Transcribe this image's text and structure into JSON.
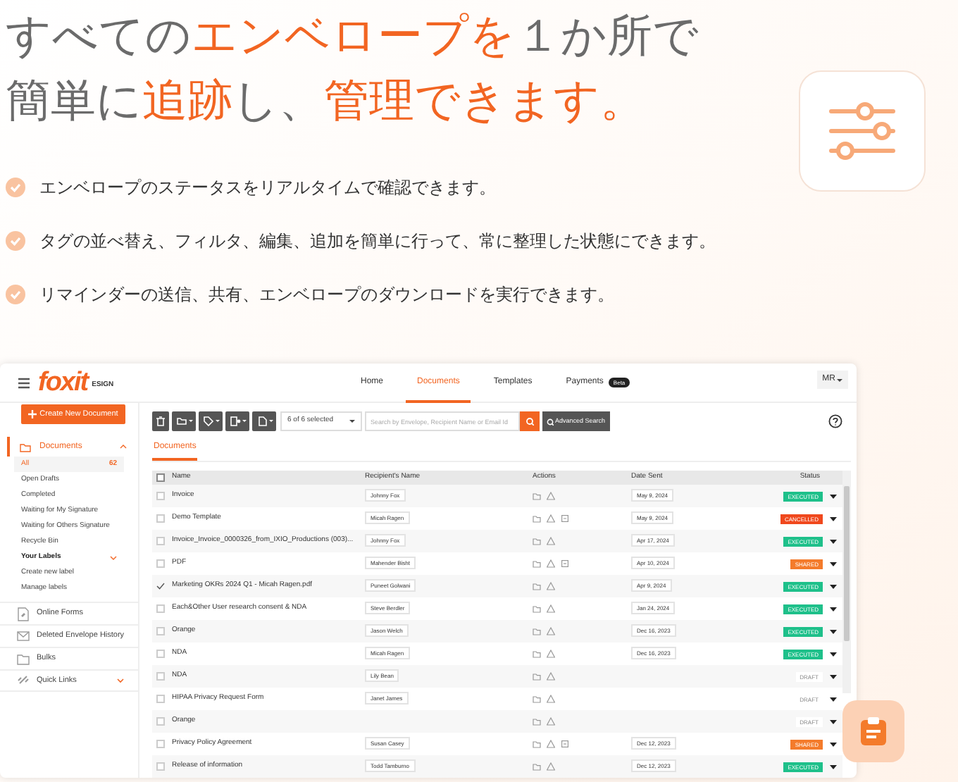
{
  "headline": [
    [
      {
        "text": "すべての",
        "accent": false
      },
      {
        "text": "エンベロープを",
        "accent": true
      },
      {
        "text": "１か所で",
        "accent": false
      }
    ],
    [
      {
        "text": "簡単に",
        "accent": false
      },
      {
        "text": "追跡",
        "accent": true
      },
      {
        "text": "し、",
        "accent": false
      },
      {
        "text": "管理できます。",
        "accent": true
      }
    ]
  ],
  "features": [
    "エンベロープのステータスをリアルタイムで確認できます。",
    "タグの並べ替え、フィルタ、編集、追加を簡単に行って、常に整理した状態にできます。",
    "リマインダーの送信、共有、エンベロープのダウンロードを実行できます。"
  ],
  "app": {
    "logo": "foxit",
    "logo_suffix": "ESIGN",
    "nav": [
      {
        "label": "Home",
        "selected": false
      },
      {
        "label": "Documents",
        "selected": true
      },
      {
        "label": "Templates",
        "selected": false
      },
      {
        "label": "Payments",
        "selected": false,
        "badge": "Beta"
      }
    ],
    "user_menu": "MR",
    "sidebar": {
      "create_button": "Create New Document",
      "folder": {
        "label": "Documents",
        "expanded": true,
        "children": [
          {
            "label": "All",
            "count": "62",
            "selected": true
          },
          {
            "label": "Open Drafts",
            "selected": false
          },
          {
            "label": "Completed",
            "selected": false
          },
          {
            "label": "Waiting for My Signature",
            "selected": false
          },
          {
            "label": "Waiting for Others Signature",
            "selected": false
          },
          {
            "label": "Recycle Bin",
            "selected": false
          }
        ]
      },
      "labels": {
        "label": "Your Labels",
        "expanded": true,
        "children": [
          {
            "label": "Create new label"
          },
          {
            "label": "Manage labels"
          }
        ]
      },
      "sections": [
        {
          "label": "Online Forms",
          "kind": "forms"
        },
        {
          "label": "Deleted Envelope History",
          "kind": "history"
        },
        {
          "label": "Bulks",
          "kind": "bulks"
        },
        {
          "label": "Quick Links",
          "kind": "links",
          "expanded": false
        }
      ]
    },
    "selection": "6 of 6 selected",
    "search": {
      "placeholder": "Search by Envelope, Recipient Name or Email Id"
    },
    "advanced_search": "Advanced Search",
    "tab": "Documents",
    "table": {
      "all_checked": false,
      "columns": [
        "Name",
        "Recipient's Name",
        "Actions",
        "Date Sent",
        "Status"
      ],
      "rows": [
        {
          "name": "Invoice",
          "recipient": "Johnny Fox",
          "copy_action": false,
          "date": "May 9, 2024",
          "status": "EXECUTED",
          "color": "#1ec08a",
          "checked": false
        },
        {
          "name": "Demo Template",
          "recipient": "Micah Ragen",
          "copy_action": true,
          "date": "May 9, 2024",
          "status": "CANCELLED",
          "color": "#f0481d",
          "checked": false
        },
        {
          "name": "Invoice_Invoice_0000326_from_IXIO_Productions (003)...",
          "recipient": "Johnny Fox",
          "copy_action": false,
          "date": "Apr 17, 2024",
          "status": "EXECUTED",
          "color": "#1ec08a",
          "checked": false
        },
        {
          "name": "PDF",
          "recipient": "Mahender Bisht",
          "copy_action": true,
          "date": "Apr 10, 2024",
          "status": "SHARED",
          "color": "#f47b2b",
          "checked": false
        },
        {
          "name": "Marketing OKRs 2024 Q1 - Micah Ragen.pdf",
          "recipient": "Puneet Golwani",
          "copy_action": false,
          "date": "Apr 9, 2024",
          "status": "EXECUTED",
          "color": "#1ec08a",
          "checked": true
        },
        {
          "name": "Each&Other User research consent & NDA",
          "recipient": "Steve Berdler",
          "copy_action": false,
          "date": "Jan 24, 2024",
          "status": "EXECUTED",
          "color": "#1ec08a",
          "checked": false
        },
        {
          "name": "Orange",
          "recipient": "Jason Welch",
          "copy_action": false,
          "date": "Dec 16, 2023",
          "status": "EXECUTED",
          "color": "#1ec08a",
          "checked": false
        },
        {
          "name": "NDA",
          "recipient": "Micah Ragen",
          "copy_action": false,
          "date": "Dec 16, 2023",
          "status": "EXECUTED",
          "color": "#1ec08a",
          "checked": false
        },
        {
          "name": "NDA",
          "recipient": "Lily Bean",
          "copy_action": false,
          "status": "DRAFT",
          "color": "#ffffff",
          "checked": false
        },
        {
          "name": "HIPAA Privacy Request Form",
          "recipient": "Janet James",
          "copy_action": false,
          "status": "DRAFT",
          "color": "#ffffff",
          "checked": false
        },
        {
          "name": "Orange",
          "copy_action": false,
          "status": "DRAFT",
          "color": "#ffffff",
          "checked": false
        },
        {
          "name": "Privacy Policy Agreement",
          "recipient": "Susan Casey",
          "copy_action": true,
          "date": "Dec 12, 2023",
          "status": "SHARED",
          "color": "#f47b2b",
          "checked": false
        },
        {
          "name": "Release of information",
          "recipient": "Todd Tamburno",
          "copy_action": false,
          "date": "Dec 12, 2023",
          "status": "EXECUTED",
          "color": "#1ec08a",
          "checked": false
        }
      ]
    }
  }
}
